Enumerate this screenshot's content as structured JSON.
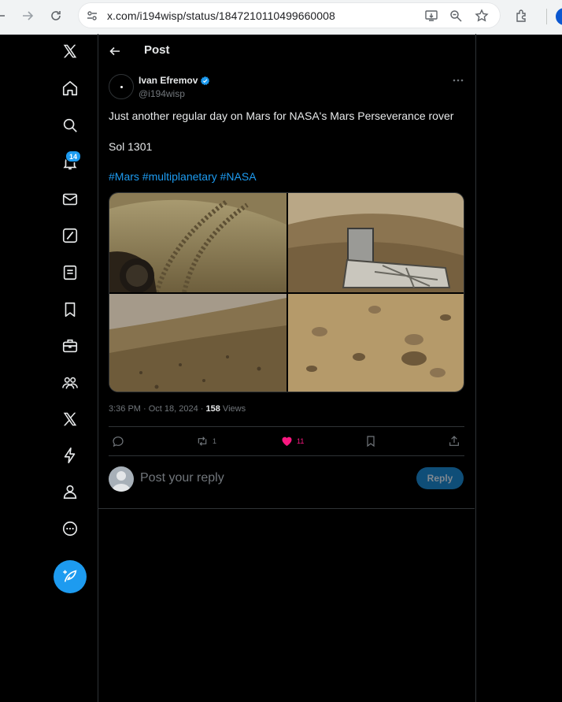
{
  "browser": {
    "url": "x.com/i194wisp/status/1847210110499660008"
  },
  "sidebar": {
    "notifications_badge": "14",
    "items": [
      {
        "icon": "x-logo-icon"
      },
      {
        "icon": "home-icon"
      },
      {
        "icon": "search-icon"
      },
      {
        "icon": "bell-icon"
      },
      {
        "icon": "mail-icon"
      },
      {
        "icon": "grok-icon"
      },
      {
        "icon": "lists-icon"
      },
      {
        "icon": "bookmark-icon"
      },
      {
        "icon": "briefcase-icon"
      },
      {
        "icon": "communities-icon"
      },
      {
        "icon": "premium-x-icon"
      },
      {
        "icon": "verified-orgs-icon"
      },
      {
        "icon": "profile-icon"
      },
      {
        "icon": "more-circle-icon"
      },
      {
        "icon": "compose-post-icon"
      }
    ]
  },
  "header": {
    "title": "Post"
  },
  "post": {
    "author_name": "Ivan Efremov",
    "author_handle": "@i194wisp",
    "text_line1": "Just another regular day on Mars for NASA's Mars Perseverance rover",
    "text_line2": "Sol 1301",
    "hashtags": [
      "#Mars",
      "#multiplanetary",
      "#NASA"
    ],
    "timestamp": "3:36 PM · Oct 18, 2024 · ",
    "views_count": "158",
    "views_label": " Views",
    "reposts": "1",
    "likes": "11"
  },
  "reply_box": {
    "placeholder": "Post your reply",
    "button_label": "Reply"
  },
  "colors": {
    "accent": "#1d9bf0",
    "like": "#f91880",
    "background": "#000000",
    "border": "#2f3336"
  }
}
